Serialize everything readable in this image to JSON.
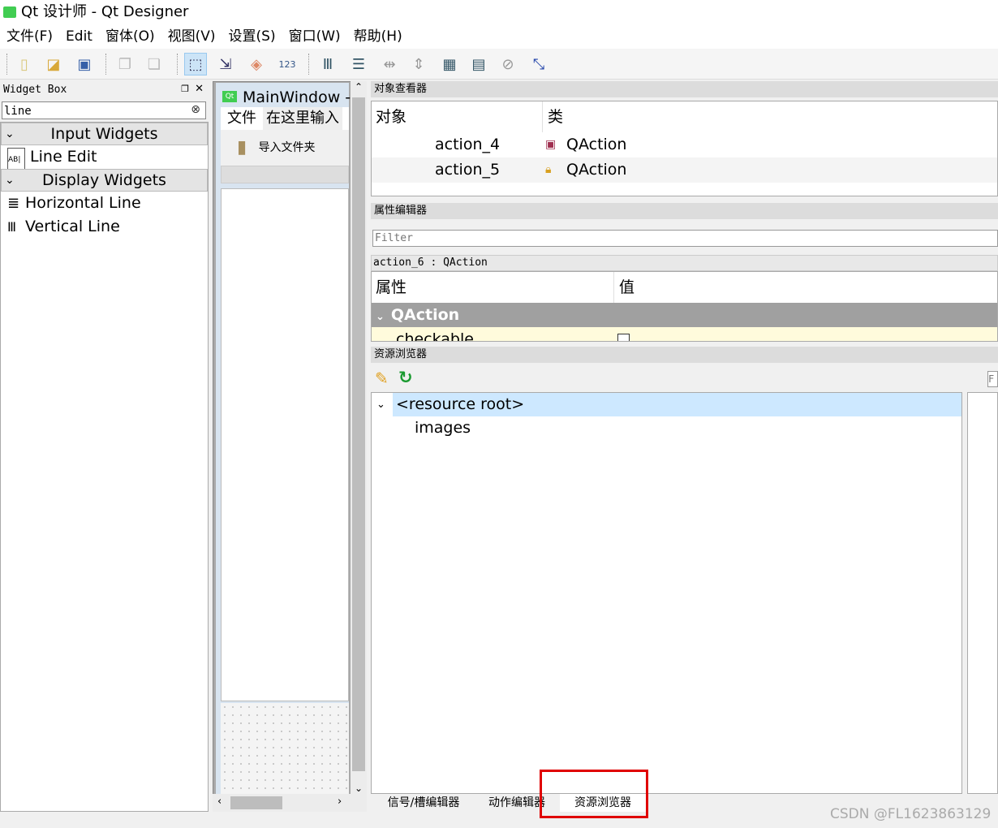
{
  "window": {
    "title": "Qt 设计师 - Qt Designer",
    "logo": "Qt"
  },
  "menu": [
    "文件(F)",
    "Edit",
    "窗体(O)",
    "视图(V)",
    "设置(S)",
    "窗口(W)",
    "帮助(H)"
  ],
  "widget_box": {
    "title": "Widget Box",
    "search": "line",
    "categories": [
      {
        "label": "Input Widgets",
        "items": [
          {
            "label": "Line Edit",
            "icon": "AB|"
          }
        ]
      },
      {
        "label": "Display Widgets",
        "items": [
          {
            "label": "Horizontal Line",
            "icon": "≣"
          },
          {
            "label": "Vertical Line",
            "icon": "Ⅲ"
          }
        ]
      }
    ]
  },
  "form": {
    "title": "MainWindow -",
    "logo": "Qt",
    "menu": [
      "文件",
      "在这里输入"
    ],
    "toolbar_action": "导入文件夹"
  },
  "object_inspector": {
    "title": "对象查看器",
    "headers": [
      "对象",
      "类"
    ],
    "rows": [
      {
        "name": "action_4",
        "class": "QAction",
        "icon": "💾"
      },
      {
        "name": "action_5",
        "class": "QAction",
        "icon": "🔒"
      }
    ]
  },
  "property_editor": {
    "title": "属性编辑器",
    "filter_placeholder": "Filter",
    "object": "action_6 : QAction",
    "headers": [
      "属性",
      "值"
    ],
    "group": "QAction",
    "rows": [
      {
        "name": "checkable"
      }
    ]
  },
  "resource_browser": {
    "title": "资源浏览器",
    "root": "<resource root>",
    "children": [
      "images"
    ],
    "filter_placeholder": "F"
  },
  "bottom_tabs": [
    "信号/槽编辑器",
    "动作编辑器",
    "资源浏览器"
  ],
  "watermark": "CSDN @FL1623863129",
  "colors": {
    "highlight": "#cde8ff",
    "group": "#a0a0a0",
    "red_box": "#e00000"
  }
}
